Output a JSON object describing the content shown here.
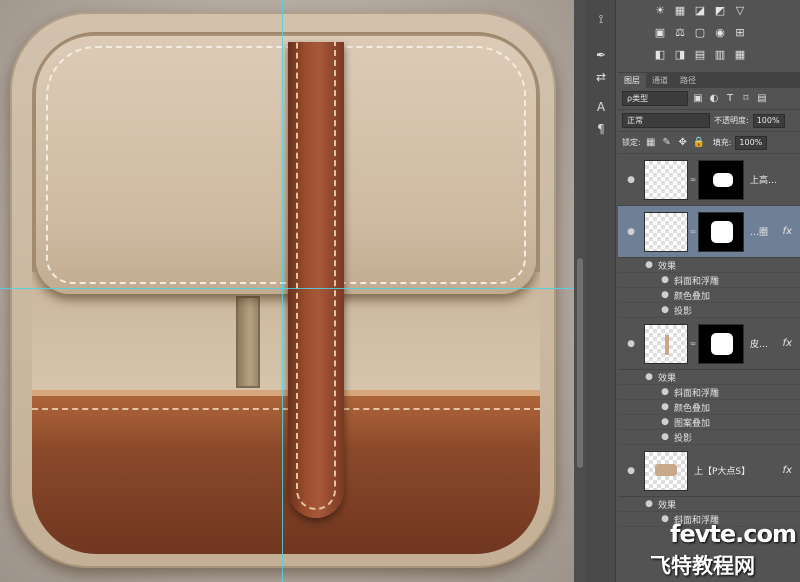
{
  "tools": {
    "icons": [
      "clone-stamp-icon",
      "pen-tool-icon",
      "path-select-icon",
      "type-tool-icon",
      "paragraph-icon"
    ],
    "glyphs": [
      "⟟",
      "✒",
      "⇄",
      "A",
      "¶"
    ]
  },
  "adjustments": {
    "row1": [
      "☀",
      "▦",
      "◪",
      "◩",
      "▽"
    ],
    "row2": [
      "▣",
      "⚖",
      "▢",
      "◉",
      "⊞"
    ],
    "row3": [
      "◧",
      "◨",
      "▤",
      "▥",
      "▦"
    ]
  },
  "layers_panel": {
    "tabs": [
      "图层",
      "通道",
      "路径"
    ],
    "filter_kind": "ρ类型",
    "blend_mode": "正常",
    "opacity_label": "不透明度:",
    "opacity_value": "100%",
    "lock_label": "锁定:",
    "fill_label": "填充:",
    "fill_value": "100%",
    "effects_label": "效果",
    "layers": [
      {
        "name": "上高…",
        "fx": "",
        "effects": []
      },
      {
        "name": "…圈",
        "fx": "fx",
        "effects": [
          "斜面和浮雕",
          "颜色叠加",
          "投影"
        ]
      },
      {
        "name": "皮…",
        "fx": "fx",
        "effects": [
          "斜面和浮雕",
          "颜色叠加",
          "图案叠加",
          "投影"
        ]
      },
      {
        "name": "上【P大点S】",
        "fx": "fx",
        "effects": [
          "斜面和浮雕"
        ]
      }
    ]
  },
  "watermark": {
    "line1": "fevte.com",
    "line2": "飞特教程网"
  },
  "colors": {
    "guide": "#4fd3e8",
    "leather": "#8c4a2b",
    "cloth": "#d2c2ad",
    "selected_layer": "#6e7f96"
  }
}
